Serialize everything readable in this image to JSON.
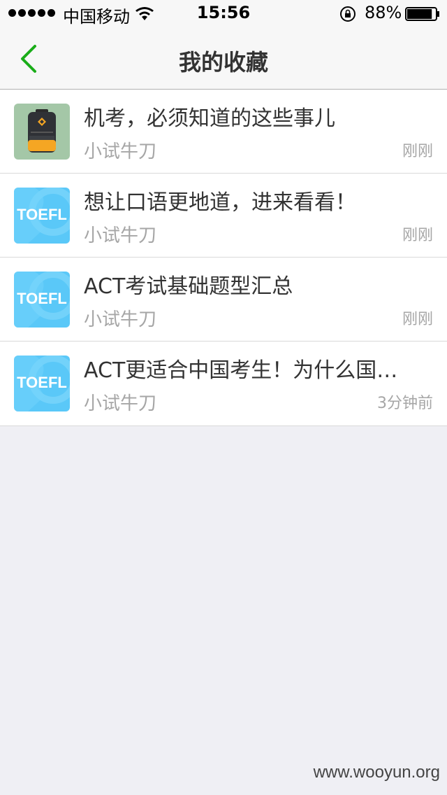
{
  "status": {
    "carrier": "中国移动",
    "time": "15:56",
    "battery_pct": "88%",
    "battery_level": 0.88,
    "signal_bars": 5
  },
  "nav": {
    "title": "我的收藏",
    "back_icon": "chevron-left-icon",
    "accent": "#1aad19"
  },
  "items": [
    {
      "thumb": "backpack",
      "title": "机考，必须知道的这些事儿",
      "source": "小试牛刀",
      "time": "刚刚"
    },
    {
      "thumb": "toefl",
      "thumb_label": "TOEFL",
      "title": "想让口语更地道，进来看看！",
      "source": "小试牛刀",
      "time": "刚刚"
    },
    {
      "thumb": "toefl",
      "thumb_label": "TOEFL",
      "title": "ACT考试基础题型汇总",
      "source": "小试牛刀",
      "time": "刚刚"
    },
    {
      "thumb": "toefl",
      "thumb_label": "TOEFL",
      "title": "ACT更适合中国考生！为什么国…",
      "source": "小试牛刀",
      "time": "3分钟前"
    }
  ],
  "watermark": "www.wooyun.org"
}
